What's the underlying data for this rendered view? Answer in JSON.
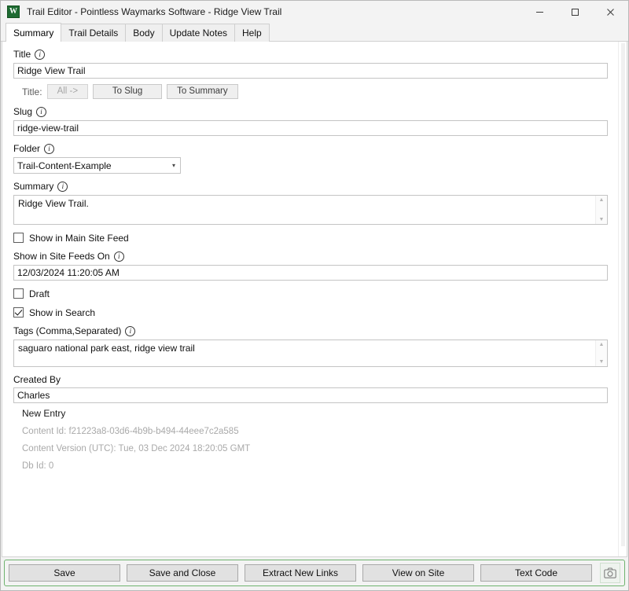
{
  "window": {
    "app_icon": "waymarks-w-icon",
    "title": "Trail Editor - Pointless Waymarks Software - Ridge View Trail",
    "controls": {
      "minimize": "minimize-icon",
      "maximize": "maximize-icon",
      "close": "close-icon"
    }
  },
  "tabs": [
    {
      "label": "Summary",
      "active": true
    },
    {
      "label": "Trail Details",
      "active": false
    },
    {
      "label": "Body",
      "active": false
    },
    {
      "label": "Update Notes",
      "active": false
    },
    {
      "label": "Help",
      "active": false
    }
  ],
  "form": {
    "title": {
      "label": "Title",
      "info": "info-icon",
      "value": "Ridge View Trail",
      "helper_caption": "Title:",
      "buttons": [
        {
          "label": "All ->",
          "disabled": true
        },
        {
          "label": "To Slug",
          "disabled": false
        },
        {
          "label": "To Summary",
          "disabled": false
        }
      ]
    },
    "slug": {
      "label": "Slug",
      "info": "info-icon",
      "value": "ridge-view-trail"
    },
    "folder": {
      "label": "Folder",
      "info": "info-icon",
      "value": "Trail-Content-Example"
    },
    "summary": {
      "label": "Summary",
      "info": "info-icon",
      "value": "Ridge View Trail."
    },
    "show_in_main_site_feed": {
      "label": "Show in Main Site Feed",
      "checked": false
    },
    "show_in_site_feeds_on": {
      "label": "Show in Site Feeds On",
      "info": "info-icon",
      "value": "12/03/2024 11:20:05 AM"
    },
    "draft": {
      "label": "Draft",
      "checked": false
    },
    "show_in_search": {
      "label": "Show in Search",
      "checked": true
    },
    "tags": {
      "label": "Tags (Comma,Separated)",
      "info": "info-icon",
      "value": "saguaro national park east, ridge view trail"
    },
    "created_by": {
      "label": "Created By",
      "value": "Charles"
    },
    "entry_status": "New Entry",
    "metadata": [
      "Content Id: f21223a8-03d6-4b9b-b494-44eee7c2a585",
      "Content Version (UTC): Tue, 03 Dec 2024 18:20:05 GMT",
      "Db Id: 0"
    ]
  },
  "toolbar": {
    "buttons": [
      "Save",
      "Save and Close",
      "Extract New Links",
      "View on Site",
      "Text Code"
    ],
    "camera_button": "camera-icon"
  },
  "colors": {
    "accent_green": "#6eb36e",
    "app_icon_green": "#1e6b32",
    "muted_text": "#a9a9a9"
  }
}
